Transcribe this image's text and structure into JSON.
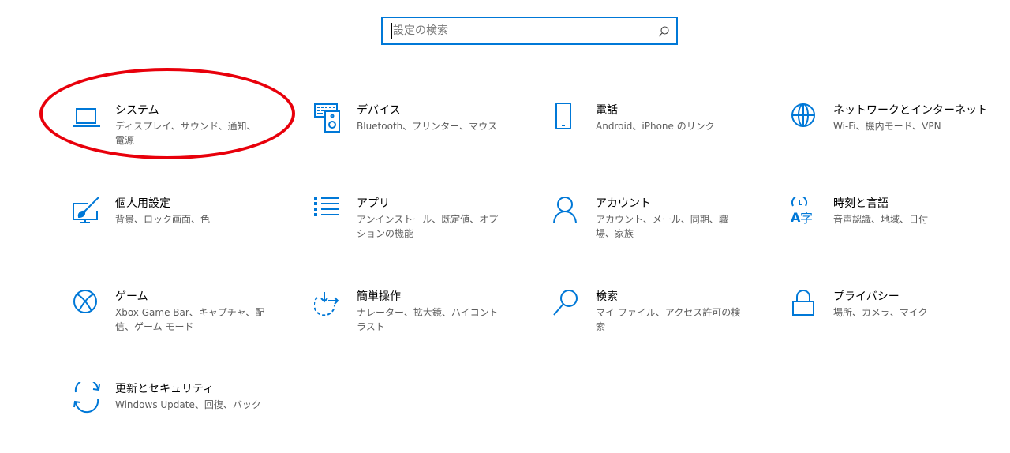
{
  "search": {
    "placeholder": "設定の検索"
  },
  "tiles": [
    {
      "title": "システム",
      "desc": "ディスプレイ、サウンド、通知、電源",
      "icon": "laptop-icon"
    },
    {
      "title": "デバイス",
      "desc": "Bluetooth、プリンター、マウス",
      "icon": "keyboard-speaker-icon"
    },
    {
      "title": "電話",
      "desc": "Android、iPhone のリンク",
      "icon": "phone-icon"
    },
    {
      "title": "ネットワークとインターネット",
      "desc": "Wi-Fi、機内モード、VPN",
      "icon": "globe-icon"
    },
    {
      "title": "個人用設定",
      "desc": "背景、ロック画面、色",
      "icon": "paint-brush-icon"
    },
    {
      "title": "アプリ",
      "desc": "アンインストール、既定値、オプションの機能",
      "icon": "app-list-icon"
    },
    {
      "title": "アカウント",
      "desc": "アカウント、メール、同期、職場、家族",
      "icon": "person-icon"
    },
    {
      "title": "時刻と言語",
      "desc": "音声認識、地域、日付",
      "icon": "time-language-icon"
    },
    {
      "title": "ゲーム",
      "desc": "Xbox Game Bar、キャプチャ、配信、ゲーム モード",
      "icon": "xbox-icon"
    },
    {
      "title": "簡単操作",
      "desc": "ナレーター、拡大鏡、ハイコントラスト",
      "icon": "ease-of-access-icon"
    },
    {
      "title": "検索",
      "desc": "マイ ファイル、アクセス許可の検索",
      "icon": "search-icon"
    },
    {
      "title": "プライバシー",
      "desc": "場所、カメラ、マイク",
      "icon": "lock-icon"
    },
    {
      "title": "更新とセキュリティ",
      "desc": "Windows Update、回復、バック",
      "icon": "sync-icon"
    }
  ],
  "colors": {
    "accent": "#0078d7",
    "highlight": "#e8000b"
  }
}
